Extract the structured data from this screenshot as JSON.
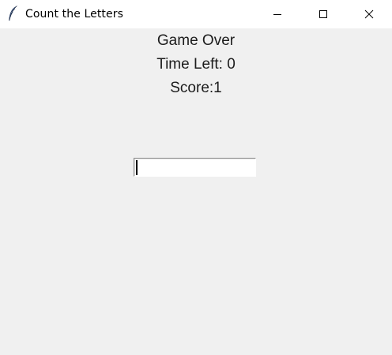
{
  "window": {
    "title": "Count the Letters",
    "app_icon": "tk-feather-icon",
    "controls": [
      "minimize-icon",
      "maximize-icon",
      "close-icon"
    ]
  },
  "game": {
    "status": "Game Over",
    "time_left": "Time Left: 0",
    "score": "Score:1"
  },
  "entry": {
    "value": "",
    "placeholder": ""
  },
  "colors": {
    "background": "#f0f0f0",
    "titlebar": "#ffffff",
    "text": "#1c1c1c"
  }
}
